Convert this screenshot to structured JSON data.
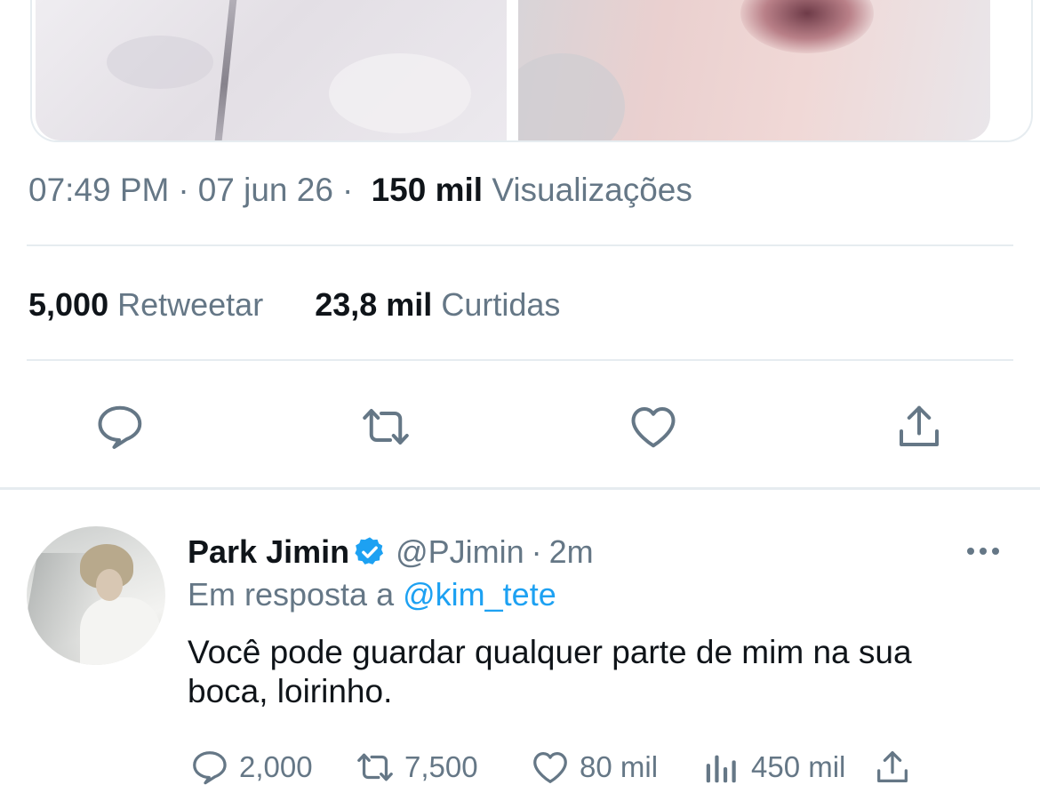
{
  "tweet": {
    "time": "07:49 PM",
    "date": "07 jun 26",
    "views_count": "150 mil",
    "views_label": "Visualizações",
    "retweets_count": "5,000",
    "retweets_label": "Retweetar",
    "likes_count": "23,8 mil",
    "likes_label": "Curtidas",
    "actions": [
      "reply-icon",
      "retweet-icon",
      "like-icon",
      "share-icon"
    ]
  },
  "reply": {
    "name": "Park Jimin",
    "handle": "@PJimin",
    "dot": "·",
    "time": "2m",
    "reply_prefix": "Em resposta a",
    "reply_mention": "@kim_tete",
    "text": "Você pode guardar qualquer parte de mim na sua boca, loirinho.",
    "reply_count": "2,000",
    "retweet_count": "7,500",
    "like_count": "80 mil",
    "views_count": "450 mil"
  },
  "colors": {
    "secondary_text": "#657786",
    "link": "#1da1f2",
    "divider": "#e6ecf0",
    "verified": "#1da1f2"
  }
}
